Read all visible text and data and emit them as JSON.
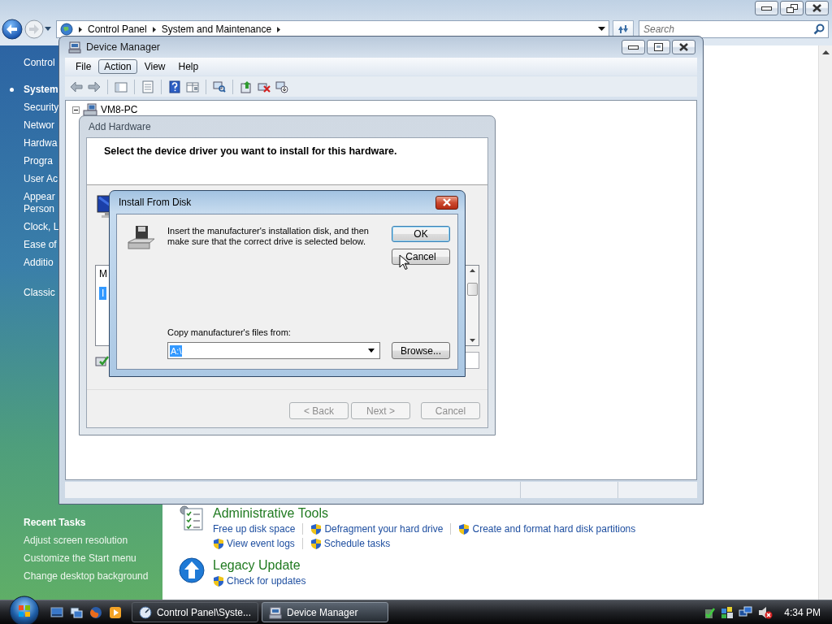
{
  "explorer": {
    "address": {
      "crumbs": [
        "Control Panel",
        "System and Maintenance"
      ]
    },
    "search": {
      "placeholder": "Search"
    },
    "sidebar": {
      "groups": [
        {
          "items": [
            {
              "label": "Control",
              "selected": false
            }
          ]
        },
        {
          "items": [
            {
              "label": "System",
              "selected": true
            },
            {
              "label": "Security",
              "selected": false
            },
            {
              "label": "Networ",
              "selected": false
            },
            {
              "label": "Hardwa",
              "selected": false
            },
            {
              "label": "Progra",
              "selected": false
            },
            {
              "label": "User Ac",
              "selected": false
            },
            {
              "label": "Appear\nPerson",
              "selected": false
            },
            {
              "label": "Clock, L",
              "selected": false
            },
            {
              "label": "Ease of",
              "selected": false
            },
            {
              "label": "Additio",
              "selected": false
            }
          ]
        },
        {
          "items": [
            {
              "label": "Classic",
              "selected": false
            }
          ]
        }
      ],
      "recent_tasks": {
        "title": "Recent Tasks",
        "items": [
          "Adjust screen resolution",
          "Customize the Start menu",
          "Change desktop background"
        ]
      }
    },
    "sections": [
      {
        "kind": "tools",
        "title": "Administrative Tools",
        "rows": [
          [
            {
              "label": "Free up disk space",
              "shield": false
            },
            {
              "label": "Defragment your hard drive",
              "shield": true
            },
            {
              "label": "Create and format hard disk partitions",
              "shield": true
            }
          ],
          [
            {
              "label": "View event logs",
              "shield": true
            },
            {
              "label": "Schedule tasks",
              "shield": true
            }
          ]
        ]
      },
      {
        "kind": "update",
        "title": "Legacy Update",
        "rows": [
          [
            {
              "label": "Check for updates",
              "shield": true
            }
          ]
        ]
      }
    ]
  },
  "device_manager": {
    "title": "Device Manager",
    "menu": [
      {
        "label": "File",
        "selected": false
      },
      {
        "label": "Action",
        "selected": true
      },
      {
        "label": "View",
        "selected": false
      },
      {
        "label": "Help",
        "selected": false
      }
    ],
    "tree": [
      {
        "label": "VM8-PC",
        "expanded": true
      }
    ]
  },
  "add_hardware": {
    "title": "Add Hardware",
    "heading": "Select the device driver you want to install for this hardware.",
    "list": {
      "column": "M",
      "items": [
        {
          "label": "I",
          "selected": true
        }
      ]
    },
    "buttons": [
      {
        "label": "< Back",
        "disabled": true
      },
      {
        "label": "Next >",
        "disabled": true
      },
      {
        "label": "Cancel",
        "disabled": true
      }
    ]
  },
  "install_from_disk": {
    "title": "Install From Disk",
    "message": "Insert the manufacturer's installation disk, and then make sure that the correct drive is selected below.",
    "buttons": [
      {
        "label": "OK",
        "default": true
      },
      {
        "label": "Cancel",
        "default": false
      }
    ],
    "source_label": "Copy manufacturer's files from:",
    "source": {
      "value": "A:\\",
      "selected": true
    },
    "browse": "Browse..."
  },
  "taskbar": {
    "tasks": [
      {
        "kind": "control-panel",
        "label": "Control Panel\\Syste...",
        "selected": false
      },
      {
        "kind": "device-manager",
        "label": "Device Manager",
        "selected": true
      }
    ],
    "clock": "4:34 PM"
  }
}
